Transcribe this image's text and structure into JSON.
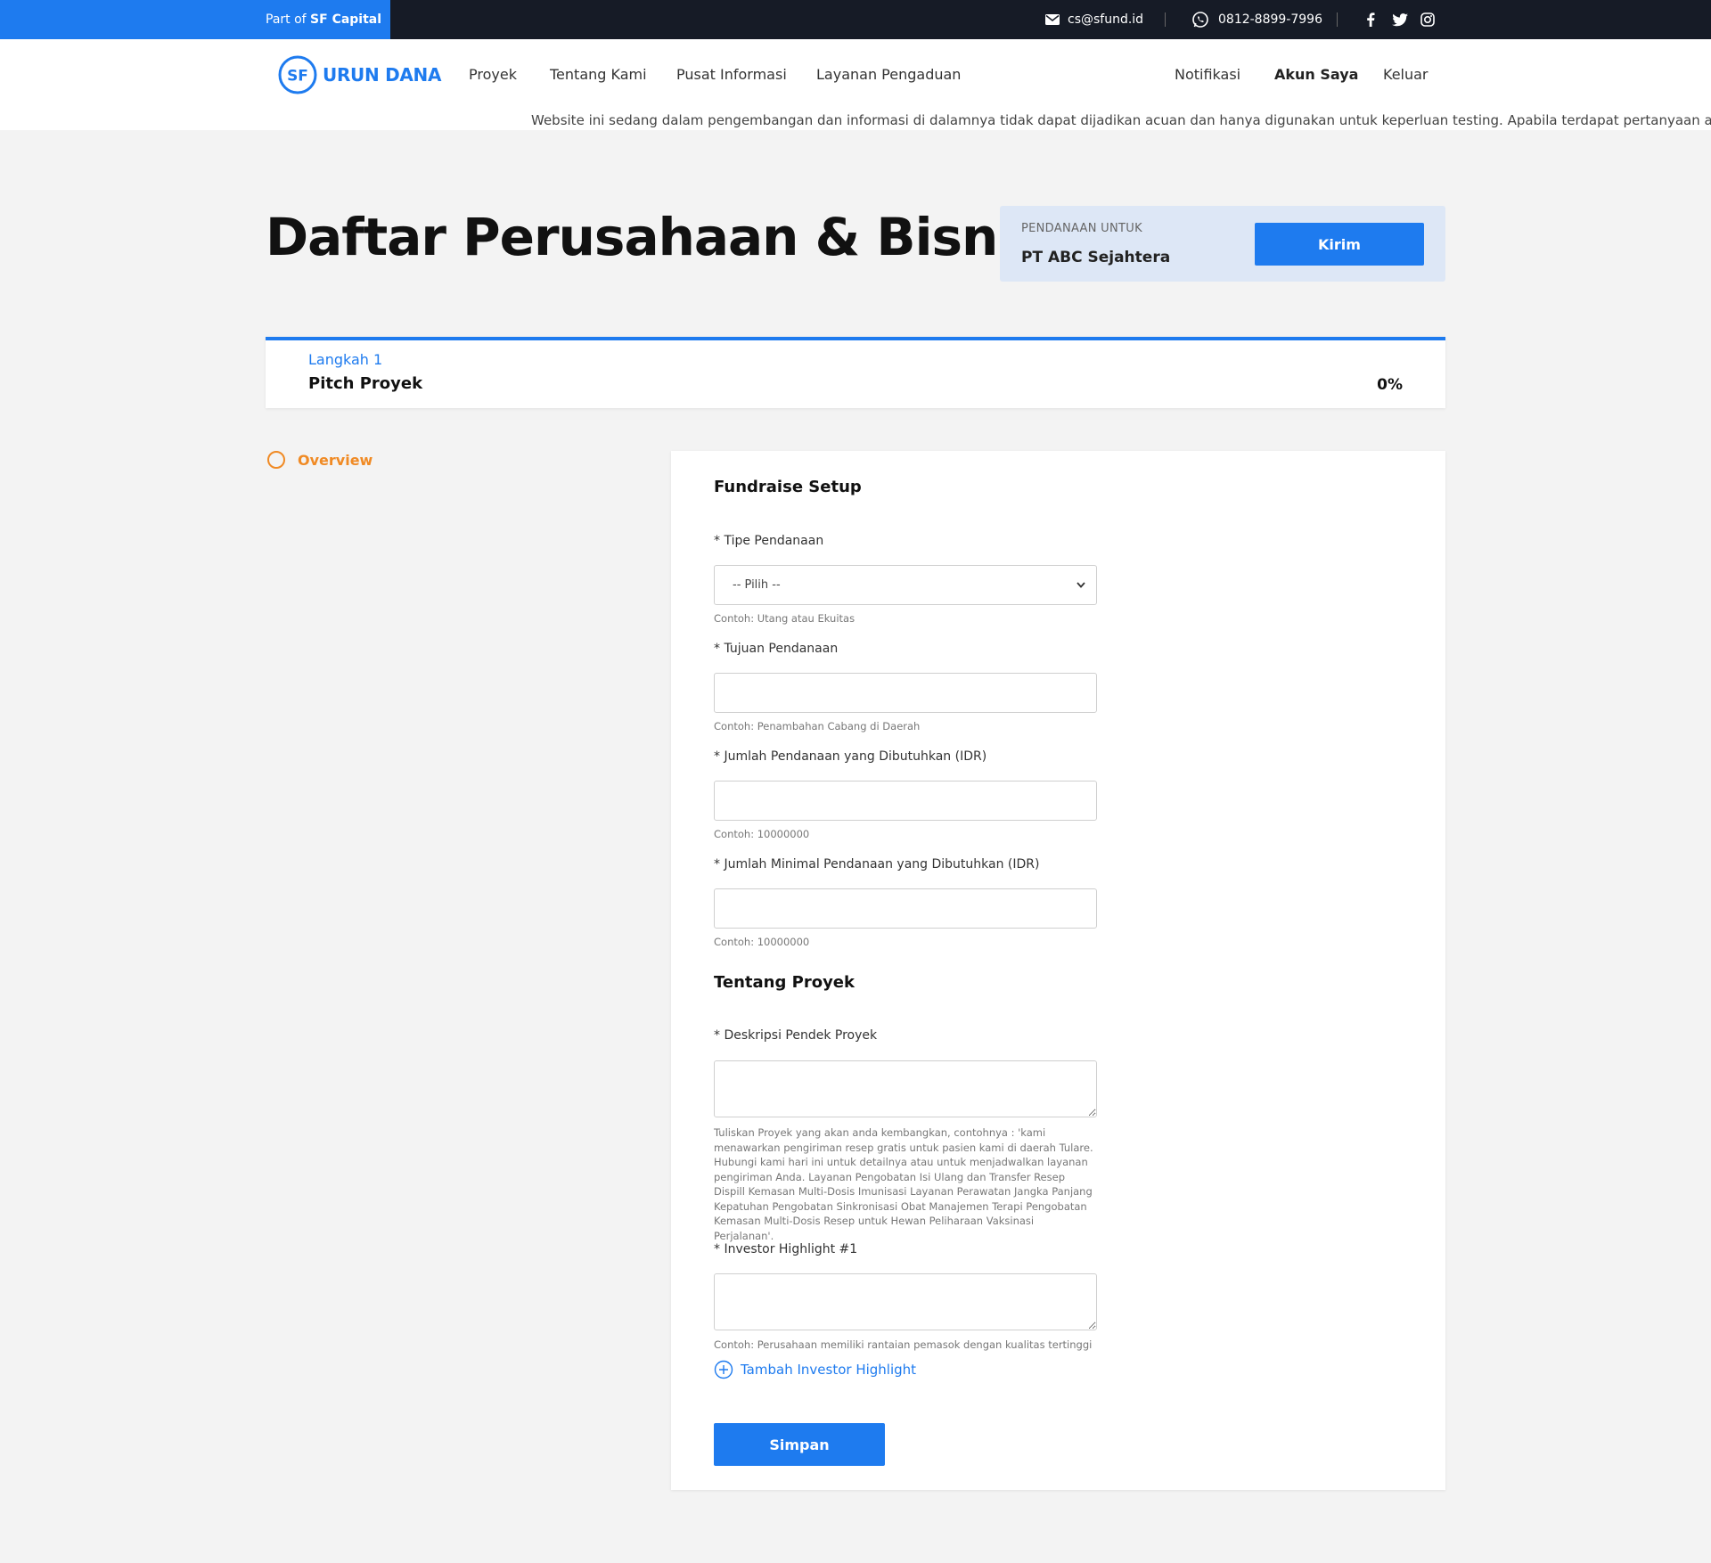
{
  "topbar": {
    "part_of": "Part of",
    "brand": "SF Capital",
    "email": "cs@sfund.id",
    "phone": "0812-8899-7996",
    "social": [
      "facebook-icon",
      "twitter-icon",
      "instagram-icon"
    ]
  },
  "nav": {
    "logo_text": "URUN DANA",
    "logo_mark": "SF",
    "items": [
      "Proyek",
      "Tentang Kami",
      "Pusat Informasi",
      "Layanan Pengaduan"
    ],
    "right_items": [
      "Notifikasi",
      "Akun Saya",
      "Keluar"
    ]
  },
  "ticker": {
    "text": "Website ini sedang dalam pengembangan dan informasi di dalamnya tidak dapat dijadikan acuan dan hanya digunakan untuk keperluan testing. Apabila terdapat pertanyaan atau"
  },
  "page": {
    "title": "Daftar Perusahaan & Bisnis"
  },
  "funding": {
    "label": "PENDANAAN UNTUK",
    "company": "PT ABC Sejahtera",
    "submit_label": "Kirim"
  },
  "step": {
    "label": "Langkah 1",
    "name": "Pitch Proyek",
    "progress": "0%"
  },
  "sidebar": {
    "items": [
      {
        "label": "Overview"
      }
    ]
  },
  "form": {
    "fundraise_title": "Fundraise Setup",
    "tipe": {
      "label": "* Tipe Pendanaan",
      "selected": "-- Pilih --",
      "hint": "Contoh: Utang atau Ekuitas"
    },
    "tujuan": {
      "label": "* Tujuan Pendanaan",
      "value": "",
      "hint": "Contoh: Penambahan Cabang di Daerah"
    },
    "jumlah": {
      "label": "* Jumlah Pendanaan yang Dibutuhkan (IDR)",
      "value": "",
      "hint": "Contoh: 10000000"
    },
    "minimal": {
      "label": "* Jumlah Minimal Pendanaan yang Dibutuhkan (IDR)",
      "value": "",
      "hint": "Contoh: 10000000"
    },
    "project_title": "Tentang Proyek",
    "deskripsi": {
      "label": "* Deskripsi Pendek Proyek",
      "value": "",
      "hint": "Tuliskan Proyek yang akan anda kembangkan, contohnya : 'kami menawarkan pengiriman resep gratis untuk pasien kami di daerah Tulare. Hubungi kami hari ini untuk detailnya atau untuk menjadwalkan layanan pengiriman Anda. Layanan Pengobatan Isi Ulang dan Transfer Resep Dispill Kemasan Multi-Dosis Imunisasi Layanan Perawatan Jangka Panjang Kepatuhan Pengobatan Sinkronisasi Obat Manajemen Terapi Pengobatan Kemasan Multi-Dosis Resep untuk Hewan Peliharaan Vaksinasi Perjalanan'."
    },
    "highlight": {
      "label": "* Investor Highlight #1",
      "value": "",
      "hint": "Contoh: Perusahaan memiliki rantaian pemasok dengan kualitas tertinggi"
    },
    "add_highlight_label": "Tambah Investor Highlight",
    "save_label": "Simpan"
  },
  "colors": {
    "accent": "#1e7bef",
    "dark": "#161b26",
    "orange": "#f08a24",
    "funding_bg": "#dde7f6"
  }
}
